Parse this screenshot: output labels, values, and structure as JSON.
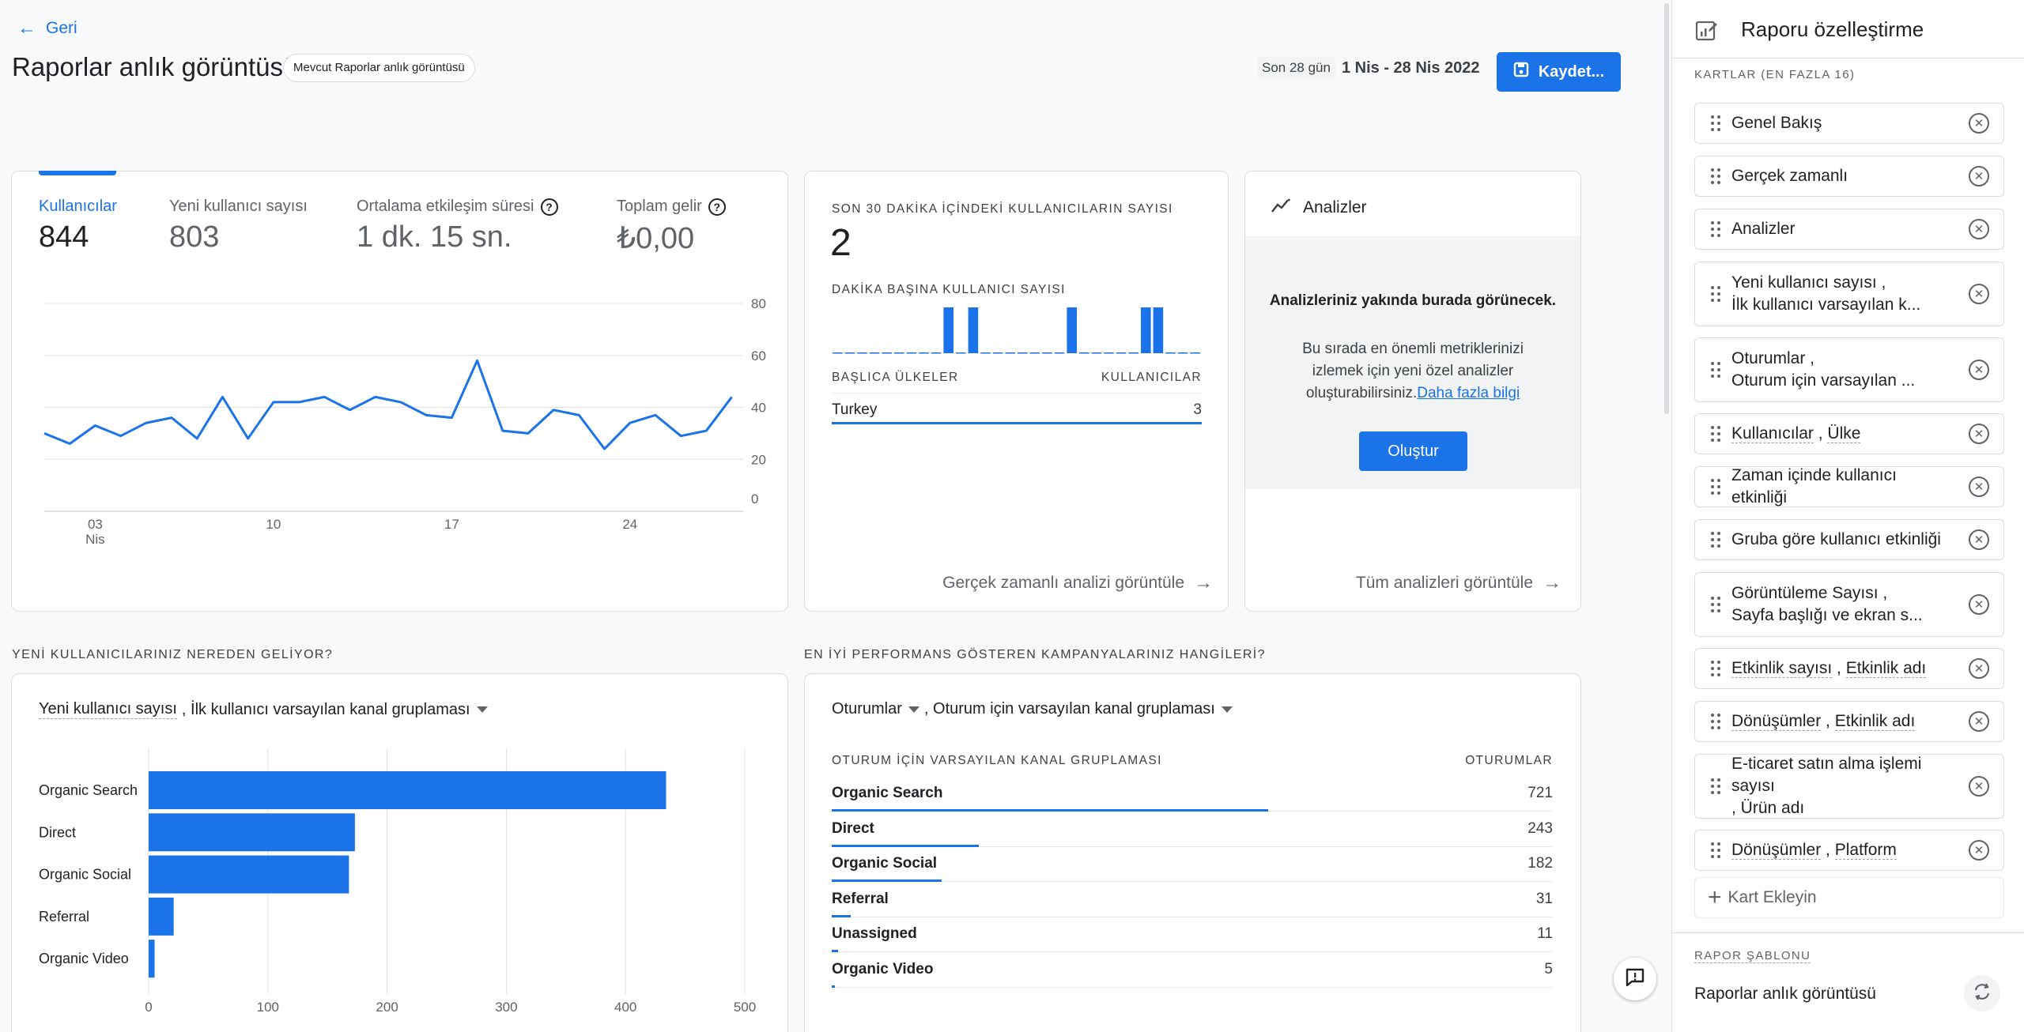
{
  "header": {
    "back_label": "Geri",
    "title": "Raporlar anlık görüntüsü",
    "badge": "Mevcut Raporlar anlık görüntüsü",
    "date_range_label": "Son 28 gün",
    "date_range": "1 Nis - 28 Nis 2022",
    "save_label": "Kaydet..."
  },
  "overview": {
    "metrics": [
      {
        "label": "Kullanıcılar",
        "value": "844"
      },
      {
        "label": "Yeni kullanıcı sayısı",
        "value": "803"
      },
      {
        "label": "Ortalama etkileşim süresi",
        "value": "1 dk. 15 sn."
      },
      {
        "label": "Toplam gelir",
        "value": "₺0,00"
      }
    ]
  },
  "realtime": {
    "title": "SON 30 DAKİKA İÇİNDEKİ KULLANICILARIN SAYISI",
    "value": "2",
    "per_minute_label": "DAKİKA BAŞINA KULLANICI SAYISI",
    "countries_header": "BAŞLICA ÜLKELER",
    "users_header": "KULLANICILAR",
    "rows": [
      {
        "country": "Turkey",
        "users": "3"
      }
    ],
    "link": "Gerçek zamanlı analizi görüntüle"
  },
  "insights": {
    "title": "Analizler",
    "heading": "Analizleriniz yakında burada görünecek.",
    "body": "Bu sırada en önemli metriklerinizi izlemek için yeni özel analizler oluşturabilirsiniz.",
    "learn_more": "Daha fazla bilgi",
    "create_button": "Oluştur",
    "link": "Tüm analizleri görüntüle"
  },
  "new_users_section": {
    "heading": "YENİ KULLANICILARINIZ NEREDEN GELİYOR?",
    "metric_select": "Yeni kullanıcı sayısı",
    "dimension_select": ", İlk kullanıcı varsayılan kanal gruplaması"
  },
  "campaigns_section": {
    "heading": "EN İYİ PERFORMANS GÖSTEREN KAMPANYALARINIZ HANGİLERİ?",
    "metric_select": "Oturumlar",
    "dimension_select": ", Oturum için varsayılan kanal gruplaması",
    "col_dimension": "OTURUM İÇİN VARSAYILAN KANAL GRUPLAMASI",
    "col_metric": "OTURUMLAR",
    "rows": [
      {
        "name": "Organic Search",
        "value": "721",
        "frac": 1.0
      },
      {
        "name": "Direct",
        "value": "243",
        "frac": 0.337
      },
      {
        "name": "Organic Social",
        "value": "182",
        "frac": 0.252
      },
      {
        "name": "Referral",
        "value": "31",
        "frac": 0.043
      },
      {
        "name": "Unassigned",
        "value": "11",
        "frac": 0.015
      },
      {
        "name": "Organic Video",
        "value": "5",
        "frac": 0.007
      }
    ]
  },
  "sidepanel": {
    "title": "Raporu özelleştirme",
    "cards_label": "KARTLAR (EN FAZLA 16)",
    "cards": [
      {
        "parts": [
          "Genel Bakış"
        ]
      },
      {
        "parts": [
          "Gerçek zamanlı"
        ]
      },
      {
        "parts": [
          "Analizler"
        ]
      },
      {
        "lines": [
          "Yeni kullanıcı sayısı ,",
          "İlk kullanıcı varsayılan k..."
        ]
      },
      {
        "lines": [
          "Oturumlar ,",
          "Oturum için varsayılan ..."
        ]
      },
      {
        "parts": [
          "Kullanıcılar",
          " , ",
          "Ülke"
        ]
      },
      {
        "parts": [
          "Zaman içinde kullanıcı etkinliği"
        ]
      },
      {
        "parts": [
          "Gruba göre kullanıcı etkinliği"
        ]
      },
      {
        "lines": [
          "Görüntüleme Sayısı ,",
          "Sayfa başlığı ve ekran s..."
        ]
      },
      {
        "parts": [
          "Etkinlik sayısı",
          " , ",
          "Etkinlik adı"
        ]
      },
      {
        "parts": [
          "Dönüşümler",
          " , ",
          "Etkinlik adı"
        ]
      },
      {
        "lines": [
          "E-ticaret satın alma işlemi sayısı",
          ", Ürün adı"
        ]
      },
      {
        "parts": [
          "Dönüşümler",
          " , ",
          "Platform"
        ]
      }
    ],
    "add_card": "Kart Ekleyin",
    "template_label": "RAPOR ŞABLONU",
    "template_name": "Raporlar anlık görüntüsü"
  },
  "chart_data": [
    {
      "type": "line",
      "x": [
        "1 Nis",
        "2 Nis",
        "3 Nis",
        "4 Nis",
        "5 Nis",
        "6 Nis",
        "7 Nis",
        "8 Nis",
        "9 Nis",
        "10 Nis",
        "11 Nis",
        "12 Nis",
        "13 Nis",
        "14 Nis",
        "15 Nis",
        "16 Nis",
        "17 Nis",
        "18 Nis",
        "19 Nis",
        "20 Nis",
        "21 Nis",
        "22 Nis",
        "23 Nis",
        "24 Nis",
        "25 Nis",
        "26 Nis",
        "27 Nis",
        "28 Nis"
      ],
      "xticks": [
        {
          "label": "03",
          "sub": "Nis",
          "index": 2
        },
        {
          "label": "10",
          "index": 9
        },
        {
          "label": "17",
          "index": 16
        },
        {
          "label": "24",
          "index": 23
        }
      ],
      "series": [
        {
          "values": [
            30,
            26,
            33,
            29,
            34,
            36,
            28,
            44,
            28,
            42,
            42,
            44,
            39,
            44,
            42,
            37,
            36,
            58,
            31,
            30,
            39,
            37,
            24,
            34,
            37,
            29,
            31,
            44
          ]
        }
      ],
      "ylim": [
        0,
        80
      ],
      "yticks": [
        0,
        20,
        40,
        60,
        80
      ],
      "grid": true,
      "color": "#1a73e8"
    },
    {
      "type": "bar",
      "x": [
        "-29",
        "-28",
        "-27",
        "-26",
        "-25",
        "-24",
        "-23",
        "-22",
        "-21",
        "-20",
        "-19",
        "-18",
        "-17",
        "-16",
        "-15",
        "-14",
        "-13",
        "-12",
        "-11",
        "-10",
        "-9",
        "-8",
        "-7",
        "-6",
        "-5",
        "-4",
        "-3",
        "-2",
        "-1",
        "0"
      ],
      "values": [
        0,
        0,
        0,
        0,
        0,
        0,
        0,
        0,
        0,
        1,
        0,
        1,
        0,
        0,
        0,
        0,
        0,
        0,
        0,
        1,
        0,
        0,
        0,
        0,
        0,
        1,
        1,
        0,
        0,
        0
      ],
      "color": "#1a73e8"
    },
    {
      "type": "bar",
      "orientation": "horizontal",
      "categories": [
        "Organic Search",
        "Direct",
        "Organic Social",
        "Referral",
        "Organic Video"
      ],
      "values": [
        434,
        173,
        168,
        21,
        5
      ],
      "xlim": [
        0,
        500
      ],
      "xticks": [
        0,
        100,
        200,
        300,
        400,
        500
      ],
      "grid": true,
      "color": "#1a73e8"
    }
  ]
}
